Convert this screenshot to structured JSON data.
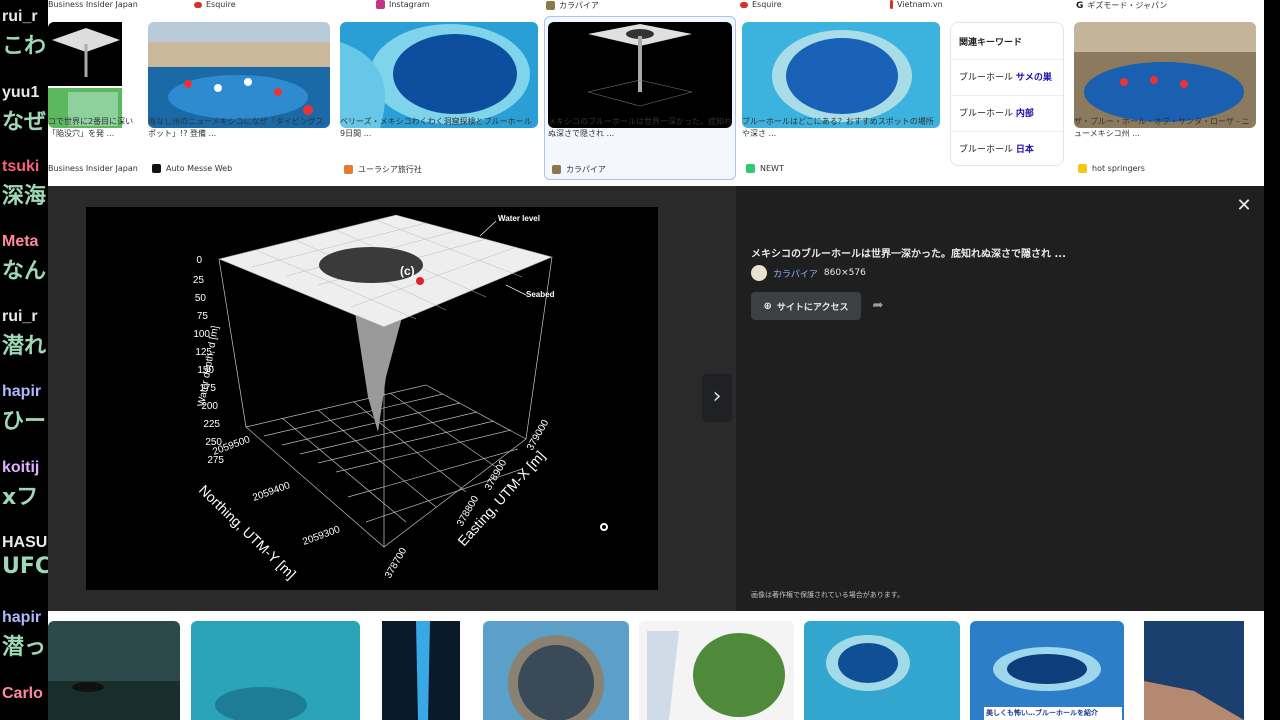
{
  "chat": [
    {
      "user": "rui_r",
      "msg": "こわ",
      "user_color": "#e8e8e8"
    },
    {
      "user": "yuu1",
      "msg": "なぜ",
      "user_color": "#e8e8e8"
    },
    {
      "user": "tsuki",
      "msg": "深海",
      "user_color": "#ff5f7a"
    },
    {
      "user": "Meta",
      "msg": "なん",
      "user_color": "#ff8aa0"
    },
    {
      "user": "rui_r",
      "msg": "潜れ",
      "user_color": "#e8e8e8"
    },
    {
      "user": "hapir",
      "msg": "ひー",
      "user_color": "#b0b7ff"
    },
    {
      "user": "koitij",
      "msg": "xフ",
      "user_color": "#e0b0ff"
    },
    {
      "user": "HASU",
      "msg": "UFC",
      "user_color": "#e8e8e8"
    },
    {
      "user": "hapir",
      "msg": "潜っ",
      "user_color": "#b0b7ff"
    },
    {
      "user": "Carlo",
      "msg": "",
      "user_color": "#ff8aa0"
    }
  ],
  "top_sources": [
    {
      "label": "Business Insider Japan",
      "color": "#ffffff"
    },
    {
      "label": "Esquire",
      "color": "#d93025"
    },
    {
      "label": "Instagram",
      "color": "#c13584"
    },
    {
      "label": "カラパイア",
      "color": "#8a7a4a"
    },
    {
      "label": "Esquire",
      "color": "#d93025"
    },
    {
      "label": "Vietnam.vn",
      "color": "#d93025"
    },
    {
      "label": "ギズモード・ジャパン",
      "color": "#202124"
    }
  ],
  "cards": [
    {
      "caption": "コで世界に2番目に深い「陥没穴」を発 ...",
      "source": "Business Insider Japan",
      "favicon": "#ffffff"
    },
    {
      "caption": "海なし州のニューメキシコになぜ「ダイビングスポット」!? 登備 ...",
      "source": "Auto Messe Web",
      "favicon": "#111111"
    },
    {
      "caption": "ベリーズ・メキシコわくわく洞窟探検とブルーホール 9日間 ...",
      "source": "ユーラシア旅行社",
      "favicon": "#e87a2e"
    },
    {
      "caption": "メキシコのブルーホールは世界一深かった。底知れぬ深さで隠され ...",
      "source": "カラパイア",
      "favicon": "#8a7a4a"
    },
    {
      "caption": "ブルーホールはどこにある？おすすめスポットの場所や深さ ...",
      "source": "NEWT",
      "favicon": "#2ecc71"
    },
    {
      "caption": "ザ・ブルー・ホール・オブ・サンタ・ローザ - ニューメキシコ州 ...",
      "source": "hot springers",
      "favicon": "#f5c518"
    }
  ],
  "related": {
    "title": "関連キーワード",
    "items": [
      {
        "prefix": "ブルーホール ",
        "bold": "サメの巣"
      },
      {
        "prefix": "ブルーホール ",
        "bold": "内部"
      },
      {
        "prefix": "ブルーホール ",
        "bold": "日本"
      }
    ]
  },
  "preview": {
    "title": "メキシコのブルーホールは世界一深かった。底知れぬ深さで隠され ...",
    "source": "カラパイア",
    "dimensions": "860×576",
    "visit_label": "サイトにアクセス",
    "copyright": "画像は著作権で保護されている場合があります。"
  },
  "figure": {
    "water_level_label": "Water level",
    "seabed_label": "Seabed",
    "panel_label": "(c)",
    "z_label": "Water depth, d [m]",
    "z_ticks": [
      "0",
      "25",
      "50",
      "75",
      "100",
      "125",
      "150",
      "175",
      "200",
      "225",
      "250",
      "275"
    ],
    "y_label": "Northing, UTM-Y [m]",
    "y_ticks": [
      "2059500",
      "2059400",
      "2059300"
    ],
    "x_label": "Easting, UTM-X [m]",
    "x_ticks": [
      "378700",
      "378800",
      "378900",
      "379000"
    ]
  },
  "bottom_thumbs": [
    "diver-photo",
    "aerial-sea",
    "cave-light",
    "sinkhole-round",
    "map-island",
    "blue-hole-1",
    "blue-hole-2",
    "sinkhole-rocks"
  ],
  "bottom_banner": "美しくも怖い…ブルーホールを紹介"
}
